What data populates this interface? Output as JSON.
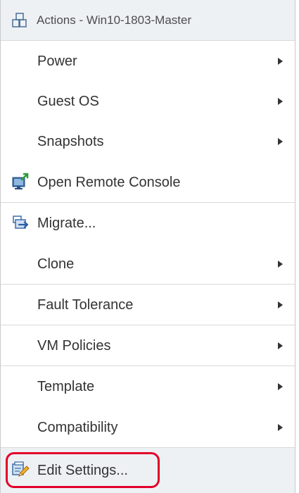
{
  "menu": {
    "header": {
      "title": "Actions - Win10-1803-Master",
      "icon": "vm-group-icon"
    },
    "items": [
      {
        "label": "Power",
        "has_submenu": true
      },
      {
        "label": "Guest OS",
        "has_submenu": true
      },
      {
        "label": "Snapshots",
        "has_submenu": true
      },
      {
        "label": "Open Remote Console",
        "has_submenu": false,
        "icon": "remote-console-icon"
      },
      {
        "label": "Migrate...",
        "has_submenu": false,
        "icon": "migrate-icon"
      },
      {
        "label": "Clone",
        "has_submenu": true
      },
      {
        "label": "Fault Tolerance",
        "has_submenu": true
      },
      {
        "label": "VM Policies",
        "has_submenu": true
      },
      {
        "label": "Template",
        "has_submenu": true
      },
      {
        "label": "Compatibility",
        "has_submenu": true
      },
      {
        "label": "Edit Settings...",
        "has_submenu": false,
        "icon": "edit-settings-icon",
        "highlighted": true
      }
    ]
  },
  "colors": {
    "header_bg": "#eef1f4",
    "divider": "#d9d9d9",
    "highlight_ring": "#e3002b",
    "text": "#333333"
  }
}
